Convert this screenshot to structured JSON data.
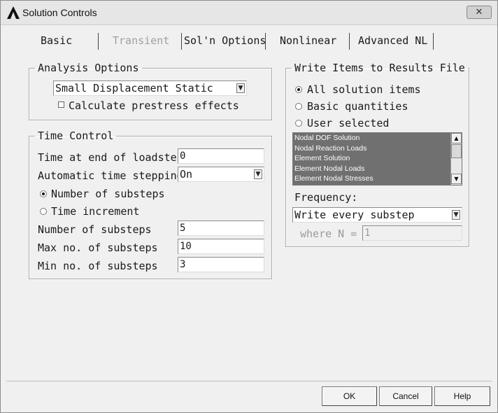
{
  "window": {
    "title": "Solution Controls",
    "close_label": "✕"
  },
  "tabs": [
    {
      "label": "Basic",
      "enabled": true,
      "selected": true
    },
    {
      "label": "Transient",
      "enabled": false
    },
    {
      "label": "Sol'n Options",
      "enabled": true
    },
    {
      "label": "Nonlinear",
      "enabled": true
    },
    {
      "label": "Advanced NL",
      "enabled": true
    }
  ],
  "analysis_options": {
    "legend": "Analysis Options",
    "type_value": "Small Displacement Static",
    "prestress_label": "Calculate prestress effects",
    "prestress_checked": false
  },
  "time_control": {
    "legend": "Time Control",
    "end_time_label": "Time at end of loadstep",
    "end_time_value": "0",
    "auto_step_label": "Automatic time stepping",
    "auto_step_value": "On",
    "radio_substeps_label": "Number of substeps",
    "radio_time_inc_label": "Time increment",
    "num_substeps_label": "Number of substeps",
    "num_substeps_value": "5",
    "max_substeps_label": "Max no. of substeps",
    "max_substeps_value": "10",
    "min_substeps_label": "Min no. of substeps",
    "min_substeps_value": "3"
  },
  "write_items": {
    "legend": "Write Items to Results File",
    "radio_all": "All solution items",
    "radio_basic": "Basic quantities",
    "radio_user": "User selected",
    "list_items": [
      "Nodal DOF Solution",
      "Nodal Reaction Loads",
      "Element Solution",
      "Element Nodal Loads",
      "Element Nodal Stresses"
    ],
    "frequency_label": "Frequency:",
    "frequency_value": "Write every substep",
    "where_label": "where N =",
    "where_value": "1"
  },
  "buttons": {
    "ok": "OK",
    "cancel": "Cancel",
    "help": "Help"
  },
  "icons": [
    "ansys-logo-icon",
    "close-icon",
    "dropdown-arrow-icon",
    "scroll-up-arrow-icon",
    "scroll-down-arrow-icon"
  ]
}
